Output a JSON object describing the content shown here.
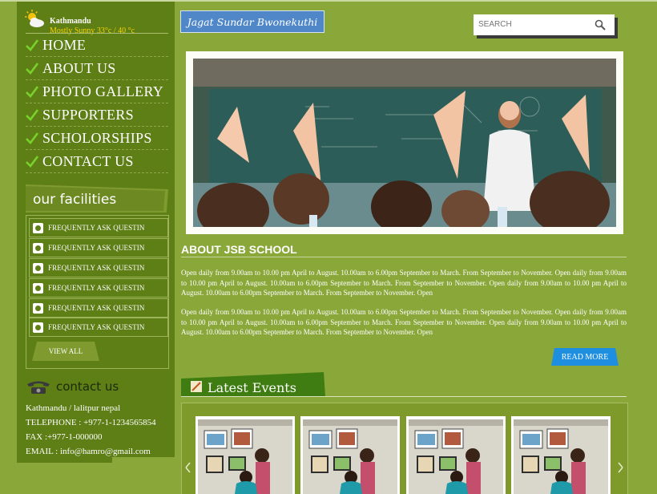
{
  "weather": {
    "city": "Kathmandu",
    "condition": "Mostly Sunny 33°c / 40 °c",
    "icon": "partly-sunny-icon"
  },
  "nav": [
    {
      "label": "HOME"
    },
    {
      "label": "ABOUT US"
    },
    {
      "label": "PHOTO GALLERY"
    },
    {
      "label": "SUPPORTERS"
    },
    {
      "label": "SCHOLORSHIPS"
    },
    {
      "label": "CONTACT US"
    }
  ],
  "facilities": {
    "title": "our facilities",
    "items": [
      {
        "label": "FREQUENTLY ASK QUESTIN"
      },
      {
        "label": "FREQUENTLY ASK QUESTIN"
      },
      {
        "label": "FREQUENTLY ASK QUESTIN"
      },
      {
        "label": "FREQUENTLY ASK QUESTIN"
      },
      {
        "label": "FREQUENTLY ASK QUESTIN"
      },
      {
        "label": "FREQUENTLY ASK QUESTIN"
      }
    ],
    "view_all": "VIEW ALL"
  },
  "contact": {
    "title": "contact us",
    "address": "Kathmandu / lalitpur nepal",
    "telephone": "TELEPHONE : +977-1-1234565854",
    "fax": "FAX :+977-1-000000",
    "email": "EMAIL : info@hamro@gmail.com"
  },
  "header": {
    "logo": "Jagat Sundar Bwonekuthi"
  },
  "search": {
    "placeholder": "SEARCH",
    "value": ""
  },
  "about": {
    "title": "ABOUT JSB SCHOOL",
    "paragraphs": [
      "Open daily from 9.00am to 10.00 pm April to August. 10.00am to 6.00pm September to March. From September to November. Open daily from 9.00am to 10.00 pm April to August. 10.00am to 6.00pm September to March. From September to November. Open daily from 9.00am to 10.00 pm April to August. 10.00am to 6.00pm September to March. From September to November. Open",
      "Open daily from 9.00am to 10.00 pm April to August. 10.00am to 6.00pm September to March. From September to November. Open daily from 9.00am to 10.00 pm April to August. 10.00am to 6.00pm September to March. From September to November. Open daily from 9.00am to 10.00 pm April to August. 10.00am to 6.00pm September to March. From September to November. Open"
    ],
    "read_more": "READ MORE"
  },
  "events": {
    "title": "Latest Events",
    "thumbnail_count": 4
  },
  "colors": {
    "page_bg": "#8aa73a",
    "sidebar_bg": "#5e7e16",
    "heading_green": "#3f7d12",
    "read_more_blue": "#1e8fe0",
    "logo_blue": "#4f87c9",
    "weather_text": "#f5d200"
  }
}
